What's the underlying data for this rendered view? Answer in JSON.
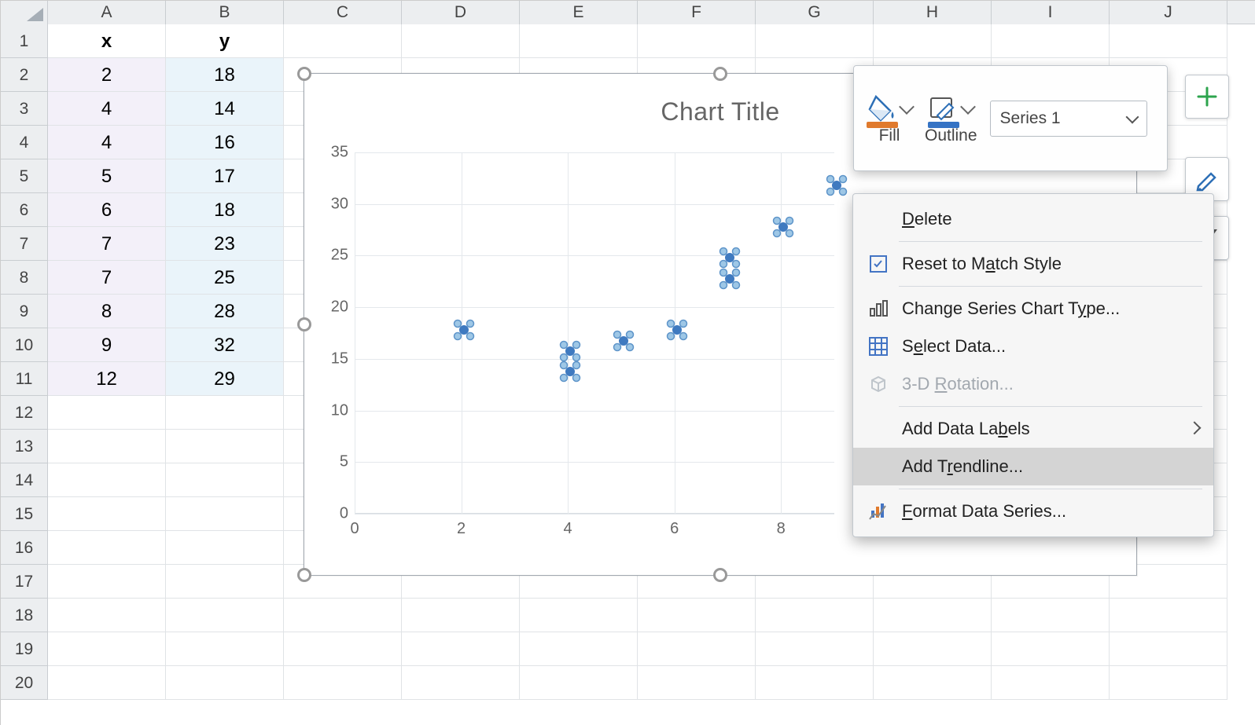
{
  "columns": [
    "A",
    "B",
    "C",
    "D",
    "E",
    "F",
    "G",
    "H",
    "I",
    "J"
  ],
  "rows": [
    "1",
    "2",
    "3",
    "4",
    "5",
    "6",
    "7",
    "8",
    "9",
    "10",
    "11",
    "12",
    "13",
    "14",
    "15",
    "16",
    "17",
    "18",
    "19",
    "20"
  ],
  "headers": {
    "x": "x",
    "y": "y"
  },
  "table": {
    "x": [
      2,
      4,
      4,
      5,
      6,
      7,
      7,
      8,
      9,
      12
    ],
    "y": [
      18,
      14,
      16,
      17,
      18,
      23,
      25,
      28,
      32,
      29
    ]
  },
  "chart_data": {
    "type": "scatter",
    "title": "Chart Title",
    "x": [
      2,
      4,
      4,
      5,
      6,
      7,
      7,
      8,
      9,
      12
    ],
    "y": [
      18,
      14,
      16,
      17,
      18,
      23,
      25,
      28,
      32,
      29
    ],
    "xticks": [
      0,
      2,
      4,
      6,
      8
    ],
    "yticks": [
      0,
      5,
      10,
      15,
      20,
      25,
      30,
      35
    ],
    "xlim": [
      0,
      9
    ],
    "ylim": [
      0,
      35
    ]
  },
  "toolbar": {
    "fill": "Fill",
    "outline": "Outline",
    "series_selected": "Series 1"
  },
  "context_menu": {
    "delete": "Delete",
    "reset": "Reset to Match Style",
    "change": "Change Series Chart Type...",
    "select": "Select Data...",
    "rotation": "3-D Rotation...",
    "labels": "Add Data Labels",
    "trendline": "Add Trendline...",
    "format": "Format Data Series..."
  }
}
